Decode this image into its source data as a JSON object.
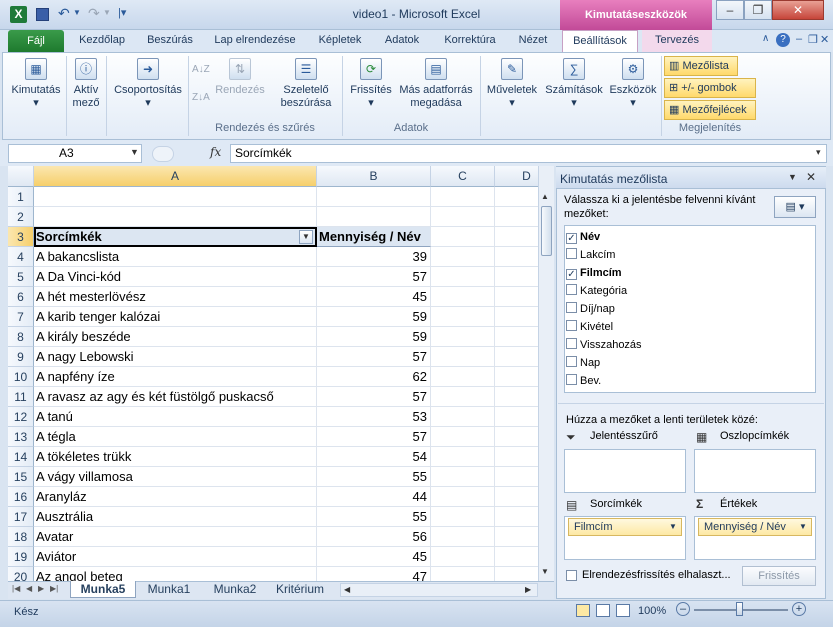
{
  "window": {
    "title": "video1  -  Microsoft Excel",
    "context_tab_header": "Kimutatáseszközök",
    "minimize": "–",
    "restore": "❐",
    "close": "✕",
    "app_icon": "X"
  },
  "ribbon_tabs": [
    "Fájl",
    "Kezdőlap",
    "Beszúrás",
    "Lap elrendezése",
    "Képletek",
    "Adatok",
    "Korrektúra",
    "Nézet",
    "Beállítások",
    "Tervezés"
  ],
  "ribbon": {
    "kimutatas": "Kimutatás",
    "aktiv_mezo": [
      "Aktív",
      "mező"
    ],
    "csoportositas": "Csoportosítás",
    "az": "A↓Z",
    "za": "Z↓A",
    "rendezes": "Rendezés",
    "szeleto": [
      "Szeletelő",
      "beszúrása"
    ],
    "frissites": "Frissítés",
    "adatforras": [
      "Más adatforrás",
      "megadása"
    ],
    "muveletek": "Műveletek",
    "szamitasok": "Számítások",
    "eszkozok": "Eszközök",
    "mezolista": "Mezőlista",
    "gombok": "+/- gombok",
    "mezofejlecek": "Mezőfejlécek",
    "group_rendezes": "Rendezés és szűrés",
    "group_adatok": "Adatok",
    "group_megjelenites": "Megjelenítés"
  },
  "formula_bar": {
    "name_box": "A3",
    "fx": "fx",
    "value": "Sorcímkék"
  },
  "grid": {
    "columns": [
      "A",
      "B",
      "C",
      "D"
    ],
    "rows": [
      {
        "n": "1",
        "a": "",
        "b": ""
      },
      {
        "n": "2",
        "a": "",
        "b": ""
      },
      {
        "n": "3",
        "a": "Sorcímkék",
        "b": "Mennyiség / Név"
      },
      {
        "n": "4",
        "a": "A bakancslista",
        "b": "39"
      },
      {
        "n": "5",
        "a": "A Da Vinci-kód",
        "b": "57"
      },
      {
        "n": "6",
        "a": "A hét mesterlövész",
        "b": "45"
      },
      {
        "n": "7",
        "a": "A karib tenger kalózai",
        "b": "59"
      },
      {
        "n": "8",
        "a": "A király beszéde",
        "b": "59"
      },
      {
        "n": "9",
        "a": "A nagy Lebowski",
        "b": "57"
      },
      {
        "n": "10",
        "a": "A napfény íze",
        "b": "62"
      },
      {
        "n": "11",
        "a": "A ravasz az agy és két füstölgő puskacső",
        "b": "57"
      },
      {
        "n": "12",
        "a": "A tanú",
        "b": "53"
      },
      {
        "n": "13",
        "a": "A tégla",
        "b": "57"
      },
      {
        "n": "14",
        "a": "A tökéletes trükk",
        "b": "54"
      },
      {
        "n": "15",
        "a": "A vágy villamosa",
        "b": "55"
      },
      {
        "n": "16",
        "a": "Aranyláz",
        "b": "44"
      },
      {
        "n": "17",
        "a": "Ausztrália",
        "b": "55"
      },
      {
        "n": "18",
        "a": "Avatar",
        "b": "56"
      },
      {
        "n": "19",
        "a": "Aviátor",
        "b": "45"
      },
      {
        "n": "20",
        "a": "Az angol beteg",
        "b": "47"
      }
    ]
  },
  "sheet_tabs": [
    "Munka5",
    "Munka1",
    "Munka2",
    "Kritérium"
  ],
  "status": {
    "ready": "Kész",
    "zoom": "100%"
  },
  "pane": {
    "title": "Kimutatás mezőlista",
    "instruction": "Válassza ki a jelentésbe felvenni kívánt mezőket:",
    "fields": [
      {
        "label": "Név",
        "checked": true
      },
      {
        "label": "Lakcím",
        "checked": false
      },
      {
        "label": "Filmcím",
        "checked": true
      },
      {
        "label": "Kategória",
        "checked": false
      },
      {
        "label": "Díj/nap",
        "checked": false
      },
      {
        "label": "Kivétel",
        "checked": false
      },
      {
        "label": "Visszahozás",
        "checked": false
      },
      {
        "label": "Nap",
        "checked": false
      },
      {
        "label": "Bev.",
        "checked": false
      }
    ],
    "drag_instruction": "Húzza a mezőket a lenti területek közé:",
    "report_filter": "Jelentésszűrő",
    "column_labels": "Oszlopcímkék",
    "row_labels": "Sorcímkék",
    "values": "Értékek",
    "row_chip": "Filmcím",
    "value_chip": "Mennyiség / Név",
    "defer_label": "Elrendezésfrissítés elhalaszt...",
    "update_button": "Frissítés"
  }
}
